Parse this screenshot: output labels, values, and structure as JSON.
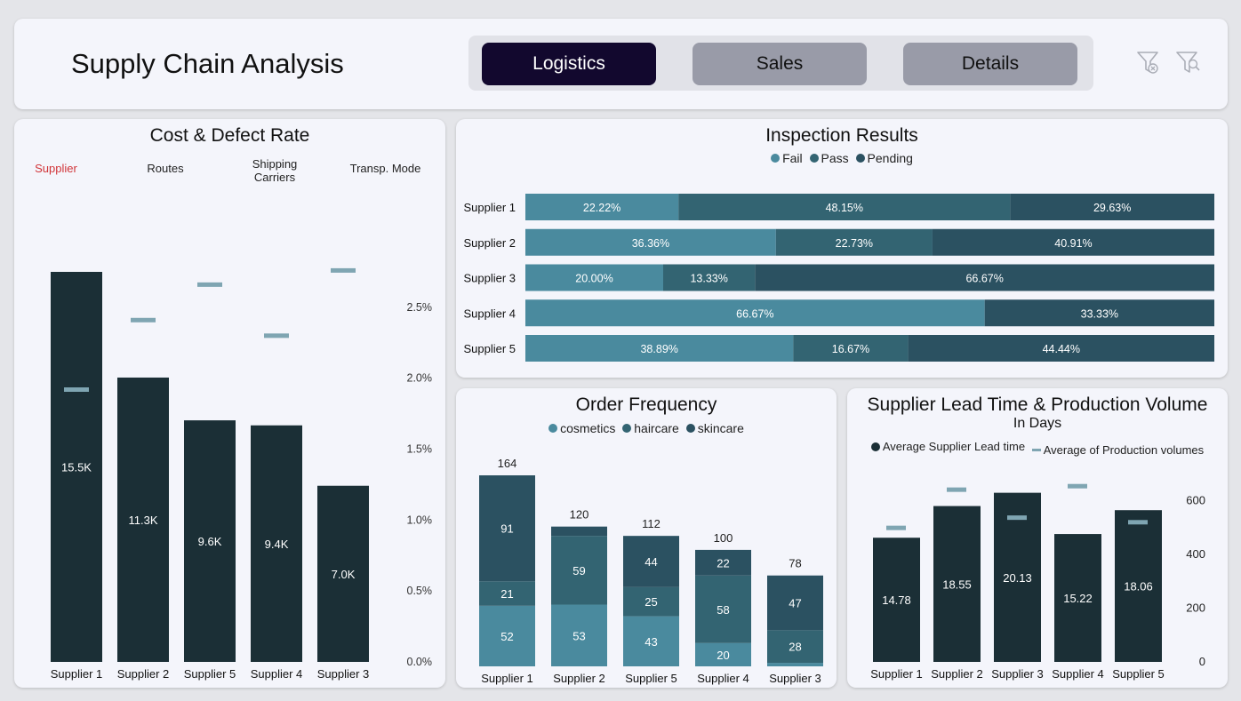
{
  "header": {
    "title": "Supply Chain Analysis",
    "tabs": [
      {
        "label": "Logistics",
        "active": true
      },
      {
        "label": "Sales",
        "active": false
      },
      {
        "label": "Details",
        "active": false
      }
    ],
    "icons": [
      "filter-clear-icon",
      "filter-search-icon"
    ]
  },
  "colors": {
    "dark_bar": "#1b2f36",
    "fail": "#4a8a9e",
    "pass": "#336472",
    "pending": "#2b5161",
    "marker": "#7fa5b2",
    "active_tab": "#12082e",
    "inactive_tab": "#999ba8",
    "active_filter": "#d13438"
  },
  "cost_defect": {
    "title": "Cost & Defect Rate",
    "filters": [
      "Supplier",
      "Routes",
      "Shipping\nCarriers",
      "Transp. Mode"
    ],
    "active_filter": "Supplier"
  },
  "inspection": {
    "title": "Inspection Results",
    "legend": [
      "Fail",
      "Pass",
      "Pending"
    ]
  },
  "order_freq": {
    "title": "Order Frequency",
    "legend": [
      "cosmetics",
      "haircare",
      "skincare"
    ]
  },
  "lead_time": {
    "title": "Supplier Lead Time & Production Volume",
    "subtitle": "In Days",
    "legend": [
      "Average Supplier Lead time",
      "Average of Production volumes"
    ]
  },
  "chart_data": [
    {
      "type": "bar",
      "id": "cost-defect",
      "title": "Cost & Defect Rate",
      "categories": [
        "Supplier 1",
        "Supplier 2",
        "Supplier 5",
        "Supplier 4",
        "Supplier 3"
      ],
      "values": [
        15.5,
        11.3,
        9.6,
        9.4,
        7.0
      ],
      "value_labels": [
        "15.5K",
        "11.3K",
        "9.6K",
        "9.4K",
        "7.0K"
      ],
      "markers": [
        1.92,
        2.41,
        2.66,
        2.3,
        2.76
      ],
      "y_max": 15.5,
      "y2_ticks": [
        "0.0%",
        "0.5%",
        "1.0%",
        "1.5%",
        "2.0%",
        "2.5%"
      ],
      "y2_values": [
        0,
        0.5,
        1.0,
        1.5,
        2.0,
        2.5
      ],
      "y2_range": [
        0,
        2.75
      ]
    },
    {
      "type": "bar",
      "id": "inspection",
      "orientation": "horizontal",
      "stacked": "100%",
      "title": "Inspection Results",
      "categories": [
        "Supplier 1",
        "Supplier 2",
        "Supplier 3",
        "Supplier 4",
        "Supplier 5"
      ],
      "series": [
        {
          "name": "Fail",
          "values": [
            22.22,
            36.36,
            20.0,
            66.67,
            38.89
          ],
          "labels": [
            "22.22%",
            "36.36%",
            "20.00%",
            "66.67%",
            "38.89%"
          ]
        },
        {
          "name": "Pass",
          "values": [
            48.15,
            22.73,
            13.33,
            0,
            16.67
          ],
          "labels": [
            "48.15%",
            "22.73%",
            "13.33%",
            "",
            "16.67%"
          ]
        },
        {
          "name": "Pending",
          "values": [
            29.63,
            40.91,
            66.67,
            33.33,
            44.44
          ],
          "labels": [
            "29.63%",
            "40.91%",
            "66.67%",
            "33.33%",
            "44.44%"
          ]
        }
      ]
    },
    {
      "type": "bar",
      "id": "order-frequency",
      "stacked": true,
      "title": "Order Frequency",
      "categories": [
        "Supplier 1",
        "Supplier 2",
        "Supplier 5",
        "Supplier 4",
        "Supplier 3"
      ],
      "totals": [
        164,
        120,
        112,
        100,
        78
      ],
      "series": [
        {
          "name": "cosmetics",
          "values": [
            52,
            53,
            43,
            20,
            3
          ],
          "labels": [
            "52",
            "53",
            "43",
            "20",
            ""
          ]
        },
        {
          "name": "haircare",
          "values": [
            21,
            59,
            25,
            58,
            28
          ],
          "labels": [
            "21",
            "59",
            "25",
            "58",
            "28"
          ]
        },
        {
          "name": "skincare",
          "values": [
            91,
            8,
            44,
            22,
            47
          ],
          "labels": [
            "91",
            "",
            "44",
            "22",
            "47"
          ]
        }
      ]
    },
    {
      "type": "bar",
      "id": "lead-time",
      "title": "Supplier Lead Time & Production Volume",
      "categories": [
        "Supplier 1",
        "Supplier 2",
        "Supplier 3",
        "Supplier 4",
        "Supplier 5"
      ],
      "series": [
        {
          "name": "Average Supplier Lead time",
          "values": [
            14.78,
            18.55,
            20.13,
            15.22,
            18.06
          ],
          "labels": [
            "14.78",
            "18.55",
            "20.13",
            "15.22",
            "18.06"
          ]
        },
        {
          "name": "Average of Production volumes",
          "values": [
            498,
            640,
            536,
            653,
            519
          ]
        }
      ],
      "y_range": [
        0,
        22.1
      ],
      "y2_ticks": [
        "0",
        "200",
        "400",
        "600"
      ],
      "y2_values": [
        0,
        200,
        400,
        600
      ],
      "y2_range": [
        0,
        690
      ]
    }
  ]
}
